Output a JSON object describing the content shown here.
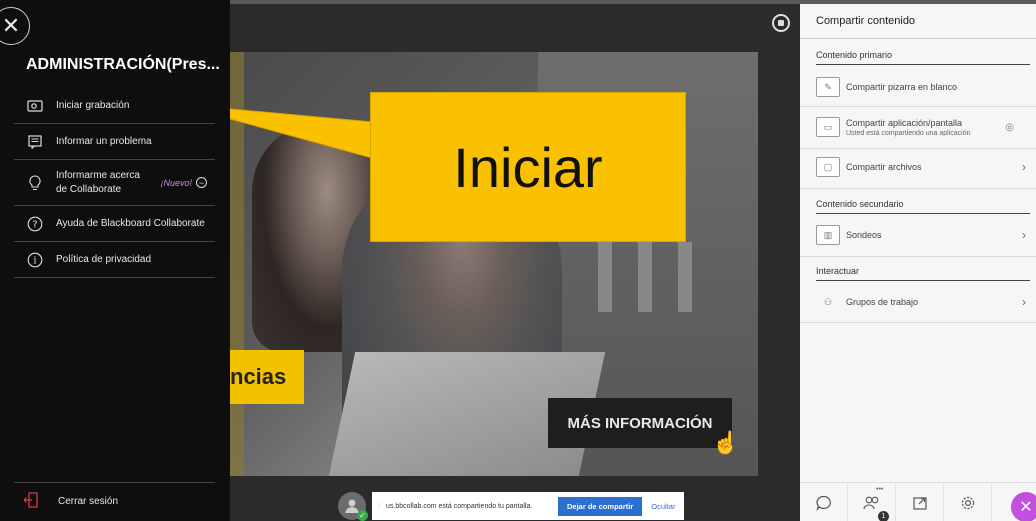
{
  "menu": {
    "close_glyph": "✕",
    "title": "ADMINISTRACIÓN(Pres...",
    "items": [
      {
        "label": "Iniciar grabación",
        "icon": "record-icon"
      },
      {
        "label": "Informar un problema",
        "icon": "report-icon"
      },
      {
        "label": "Informarme acerca de Collaborate",
        "icon": "lightbulb-icon",
        "badge": "¡Nuevo!"
      },
      {
        "label": "Ayuda de Blackboard Collaborate",
        "icon": "help-icon"
      },
      {
        "label": "Política de privacidad",
        "icon": "info-icon"
      }
    ],
    "logout": "Cerrar sesión"
  },
  "stage": {
    "image_tag": "ncias",
    "more_info": "MÁS INFORMACIÓN"
  },
  "callout": {
    "text": "Iniciar"
  },
  "share_notice": {
    "text": "us.bbcollab.com está compartiendo tu pantalla.",
    "stop_label": "Dejar de compartir",
    "hide_label": "Ocultar"
  },
  "panel": {
    "title": "Compartir contenido",
    "primary_title": "Contenido primario",
    "whiteboard": "Compartir pizarra en blanco",
    "app_share": "Compartir aplicación/pantalla",
    "app_share_sub": "Usted está compartiendo una aplicación",
    "files": "Compartir archivos",
    "secondary_title": "Contenido secundario",
    "polls": "Sondeos",
    "interact_title": "Interactuar",
    "groups": "Grupos de trabajo",
    "participants_badge": "1"
  },
  "colors": {
    "callout": "#f9c100",
    "accent_purple": "#c24fdd",
    "button_blue": "#2b6fd1",
    "new_badge": "#c78bf0"
  }
}
